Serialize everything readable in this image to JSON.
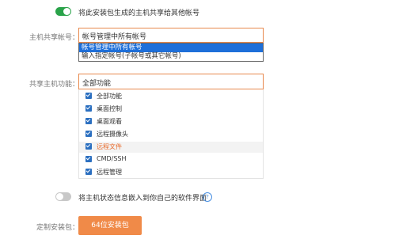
{
  "share_toggle": {
    "label": "将此安装包生成的主机共享给其他帐号",
    "on": true
  },
  "host_share_account": {
    "label": "主机共享帐号：",
    "value": "帐号管理中所有帐号",
    "options": [
      {
        "label": "帐号管理中所有帐号",
        "selected": true
      },
      {
        "label": "输入指定帐号(子帐号或其它帐号)",
        "selected": false
      }
    ]
  },
  "shared_functions": {
    "label": "共享主机功能：",
    "value": "全部功能",
    "items": [
      {
        "label": "全部功能",
        "checked": true
      },
      {
        "label": "桌面控制",
        "checked": true
      },
      {
        "label": "桌面观看",
        "checked": true
      },
      {
        "label": "远程摄像头",
        "checked": true
      },
      {
        "label": "远程文件",
        "checked": true,
        "highlighted": true
      },
      {
        "label": "CMD/SSH",
        "checked": true
      },
      {
        "label": "远程管理",
        "checked": true
      }
    ]
  },
  "embed_toggle": {
    "label": "将主机状态信息嵌入到你自己的软件界面",
    "on": false,
    "help_icon": "question-circle-icon",
    "help_glyph": "?"
  },
  "custom_package": {
    "label": "定制安装包：",
    "button_label": "64位安装包"
  },
  "colors": {
    "accent": "#f08a48",
    "toggle_on": "#2aa34a",
    "select_border": "#e8894d",
    "selected_option": "#1e6fd9",
    "checkbox": "#2b6fc0"
  }
}
